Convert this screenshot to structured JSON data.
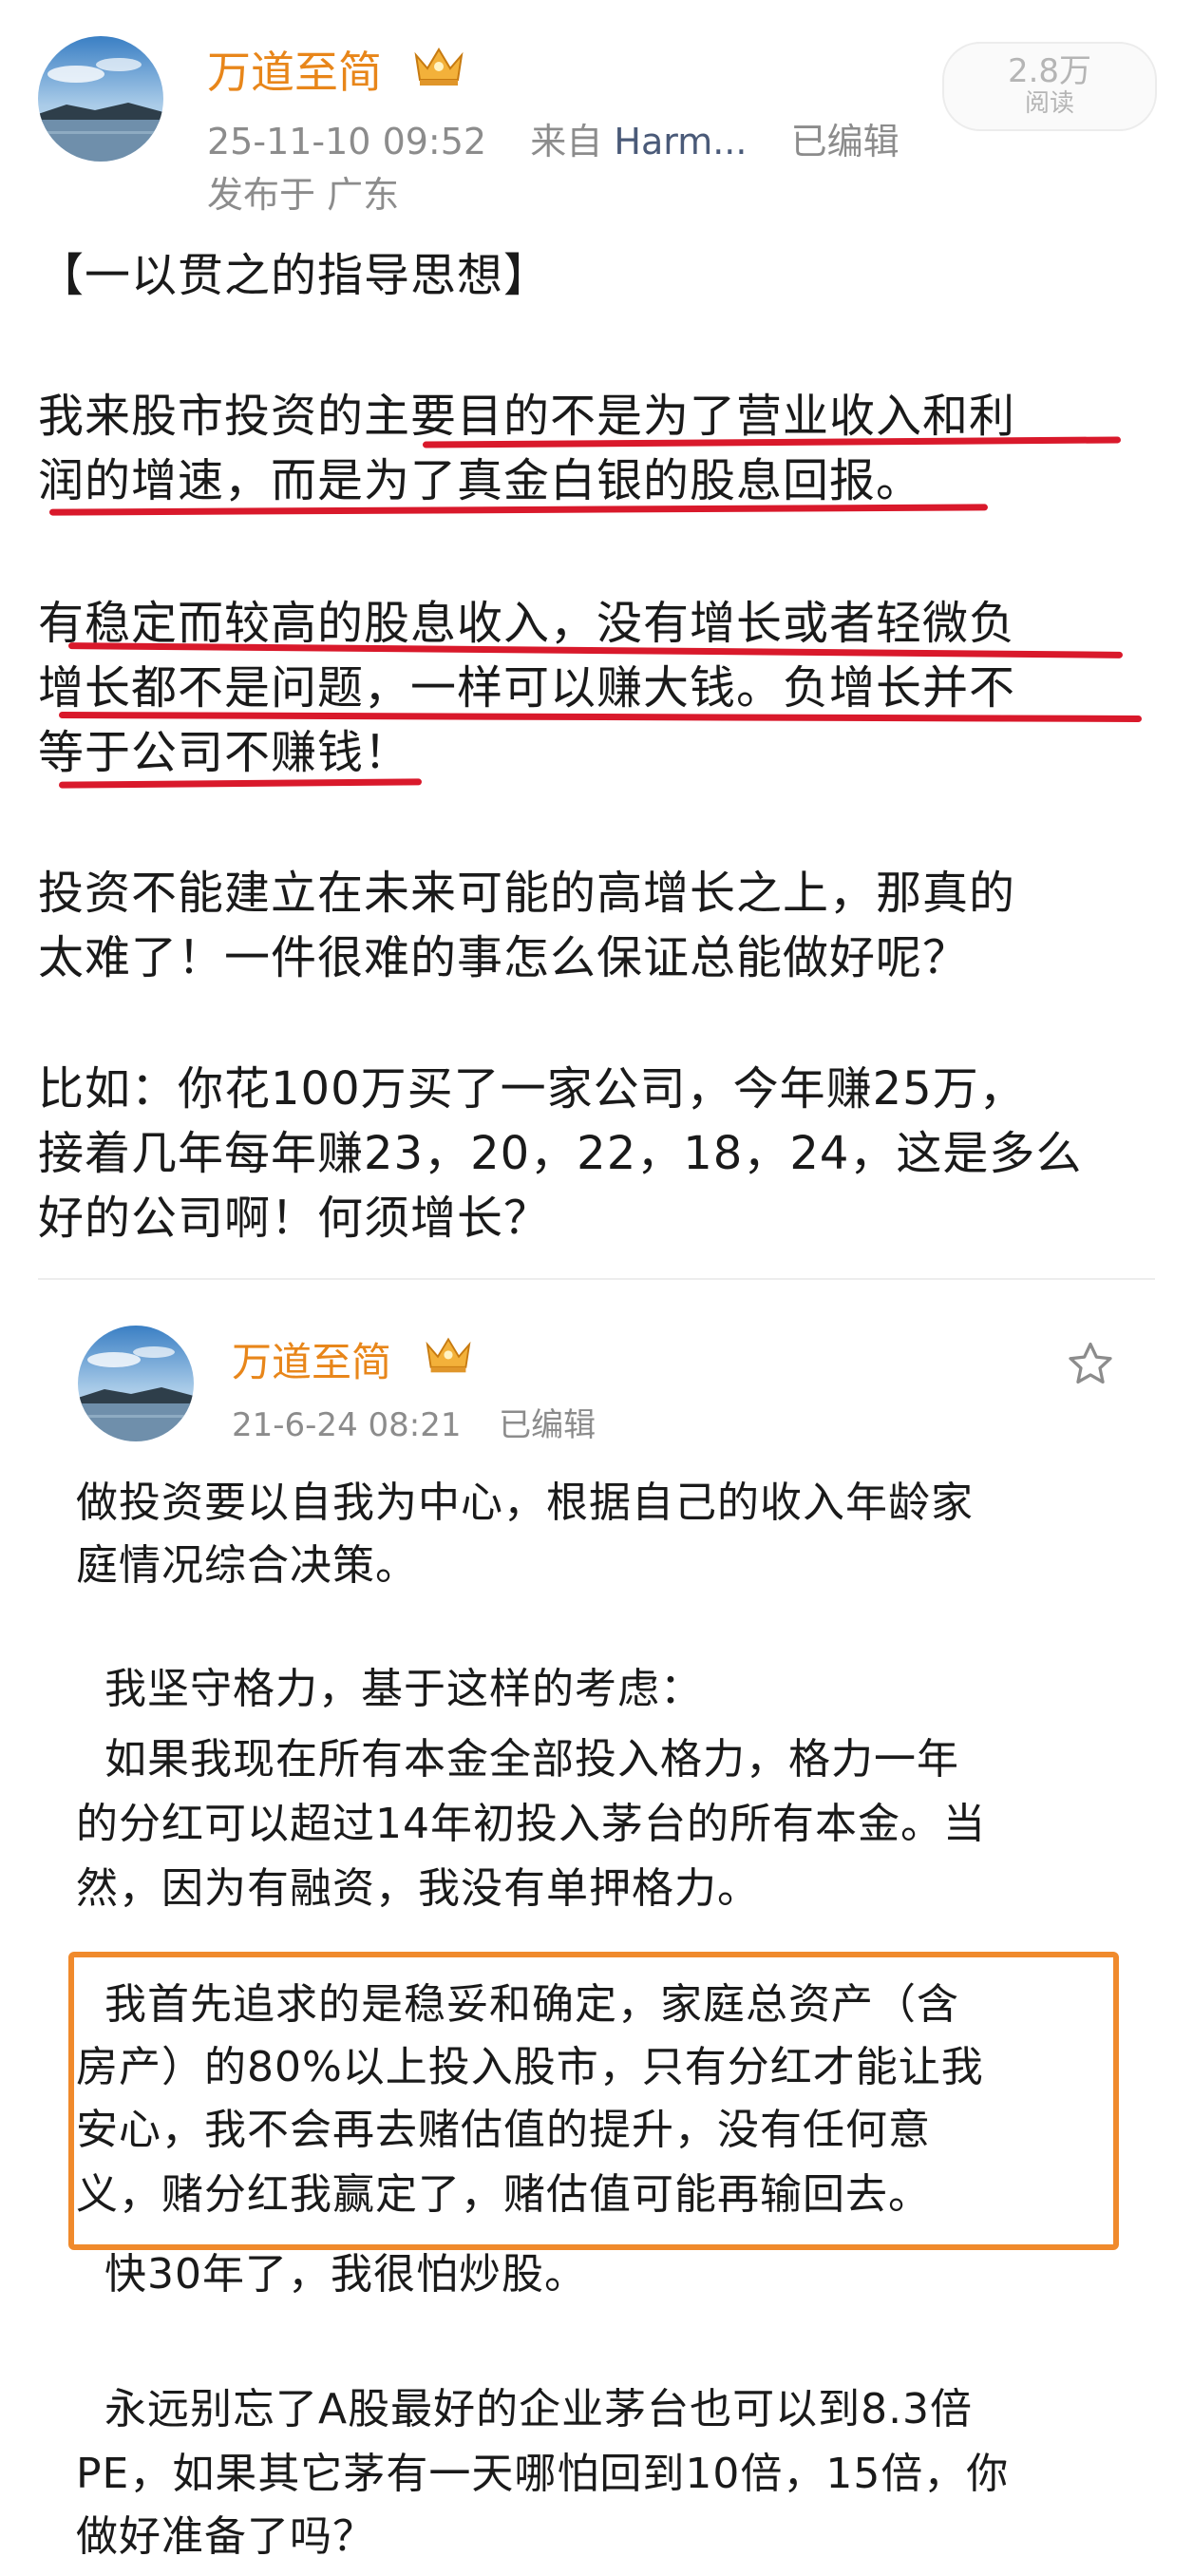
{
  "post": {
    "author": "万道至简",
    "timestamp": "25-11-10 09:52",
    "source_prefix": "来自",
    "source": "Harm...",
    "edited": "已编辑",
    "location": "发布于 广东",
    "read_count": "2.8万",
    "read_label": "阅读",
    "lines": [
      "【一以贯之的指导思想】",
      "我来股市投资的主要目的不是为了营业收入和利",
      "润的增速，而是为了真金白银的股息回报。",
      "有稳定而较高的股息收入，没有增长或者轻微负",
      "增长都不是问题，一样可以赚大钱。负增长并不",
      "等于公司不赚钱！",
      "投资不能建立在未来可能的高增长之上，那真的",
      "太难了！一件很难的事怎么保证总能做好呢？",
      "比如：你花100万买了一家公司，今年赚25万，",
      "接着几年每年赚23，20，22，18，24，这是多么",
      "好的公司啊！何须增长？"
    ]
  },
  "quoted": {
    "author": "万道至简",
    "timestamp": "21-6-24 08:21",
    "edited": "已编辑",
    "lines": [
      "做投资要以自我为中心，根据自己的收入年龄家",
      "庭情况综合决策。",
      "  我坚守格力，基于这样的考虑：",
      "  如果我现在所有本金全部投入格力，格力一年",
      "的分红可以超过14年初投入茅台的所有本金。当",
      "然，因为有融资，我没有单押格力。",
      "  我首先追求的是稳妥和确定，家庭总资产（含",
      "房产）的80%以上投入股市，只有分红才能让我",
      "安心，我不会再去赌估值的提升，没有任何意",
      "义，赌分红我赢定了，赌估值可能再输回去。",
      "  快30年了，我很怕炒股。",
      "  永远别忘了A股最好的企业茅台也可以到8.3倍",
      "PE，如果其它茅有一天哪怕回到10倍，15倍，你",
      "做好准备了吗？"
    ]
  },
  "colors": {
    "author": "#e8861a",
    "underline": "#d9192b",
    "highlight_box": "#f08a2c"
  }
}
